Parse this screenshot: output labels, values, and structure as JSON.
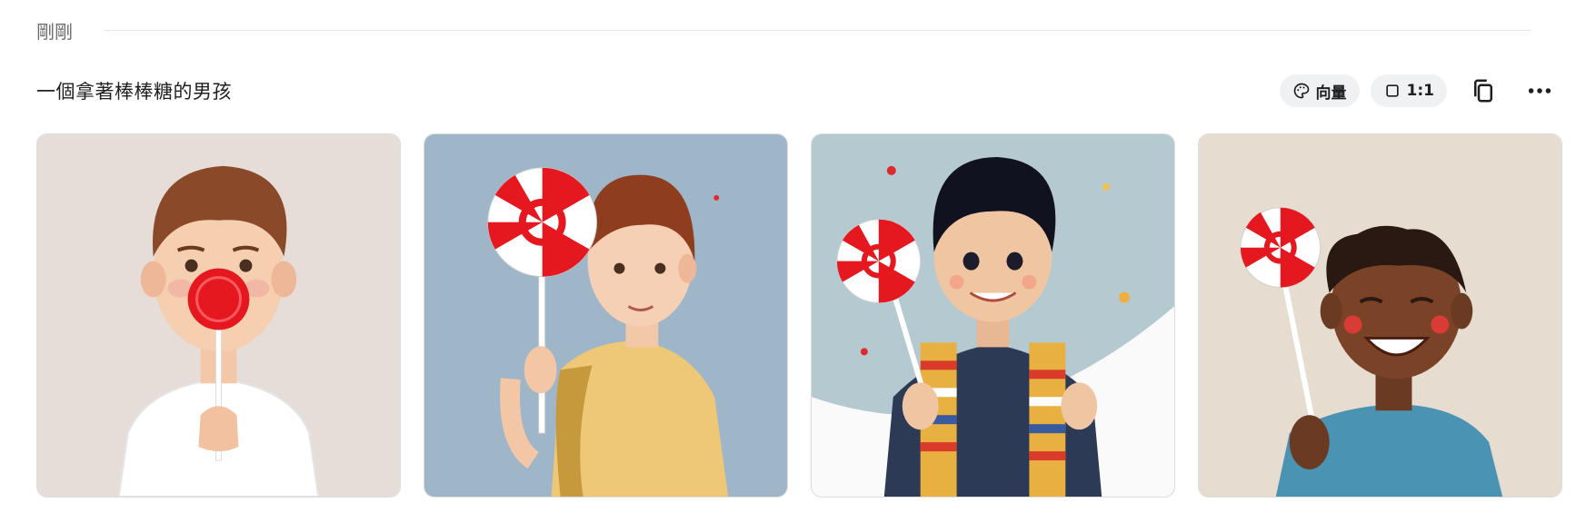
{
  "section": {
    "time_label": "剛剛"
  },
  "prompt": {
    "text": "一個拿著棒棒糖的男孩"
  },
  "toolbar": {
    "style_chip": {
      "label": "向量",
      "icon": "palette-icon"
    },
    "ratio_chip": {
      "label": "1:1",
      "icon": "square-icon"
    },
    "copy_icon": "copy-icon",
    "more_icon": "more-horizontal-icon"
  },
  "images": [
    {
      "name": "generated-image-1",
      "background": "#e6dcd8"
    },
    {
      "name": "generated-image-2",
      "background": "#9fb6c9"
    },
    {
      "name": "generated-image-3",
      "background": "#b5c9d1"
    },
    {
      "name": "generated-image-4",
      "background": "#e6ddd0"
    }
  ]
}
